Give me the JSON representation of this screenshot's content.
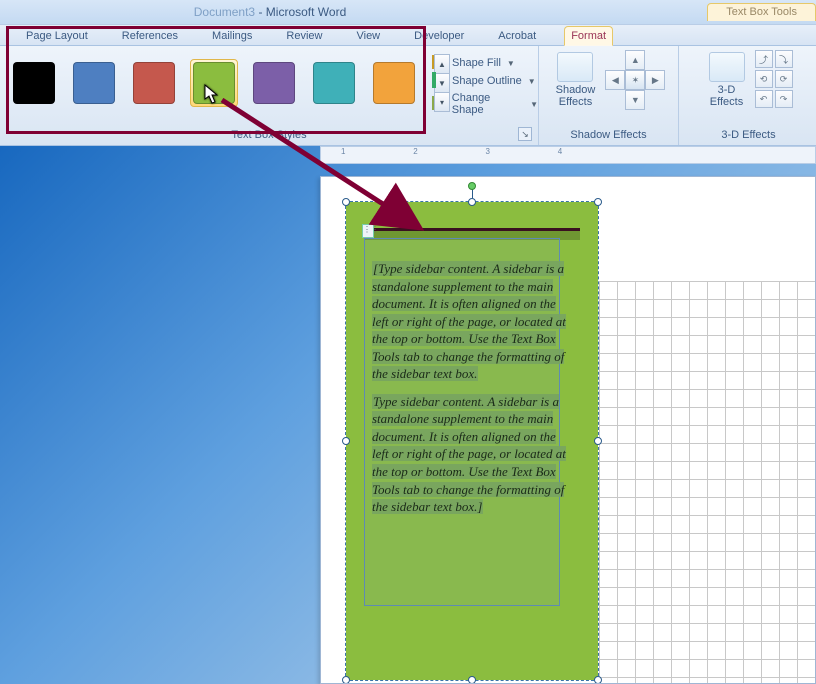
{
  "title_bar": {
    "document_name": "Document3",
    "app_name": "Microsoft Word",
    "contextual_tab_group": "Text Box Tools"
  },
  "ribbon": {
    "tabs": [
      "Page Layout",
      "References",
      "Mailings",
      "Review",
      "View",
      "Developer",
      "Acrobat",
      "Format"
    ],
    "active_tab": "Format",
    "styles_group": {
      "label": "Text Box Styles",
      "swatches": [
        {
          "color": "#000000",
          "name": "black"
        },
        {
          "color": "#4e7fc1",
          "name": "blue"
        },
        {
          "color": "#c5584d",
          "name": "red"
        },
        {
          "color": "#8bbd3f",
          "name": "olive-green",
          "hovered": true
        },
        {
          "color": "#7c5fa8",
          "name": "purple"
        },
        {
          "color": "#3fb0b8",
          "name": "teal"
        },
        {
          "color": "#f2a33c",
          "name": "orange"
        }
      ],
      "shape_fill": "Shape Fill",
      "shape_outline": "Shape Outline",
      "change_shape": "Change Shape"
    },
    "shadow_group": {
      "button": "Shadow\nEffects",
      "label": "Shadow Effects"
    },
    "threeD_group": {
      "button": "3-D\nEffects",
      "label": "3-D Effects"
    }
  },
  "ruler": {
    "numbers": [
      "1",
      "2",
      "3",
      "4"
    ]
  },
  "textbox": {
    "para1": "[Type sidebar content. A sidebar is a standalone supplement to the main document. It is often aligned on the left or right of the page, or located at the top or bottom. Use the Text Box Tools tab to change the formatting of the sidebar text box.",
    "para2": "Type sidebar content. A sidebar is a standalone supplement to the main document. It is often aligned on the left or right of the page, or located at the top or bottom. Use the Text Box Tools tab to change the formatting of the sidebar text box.]"
  }
}
